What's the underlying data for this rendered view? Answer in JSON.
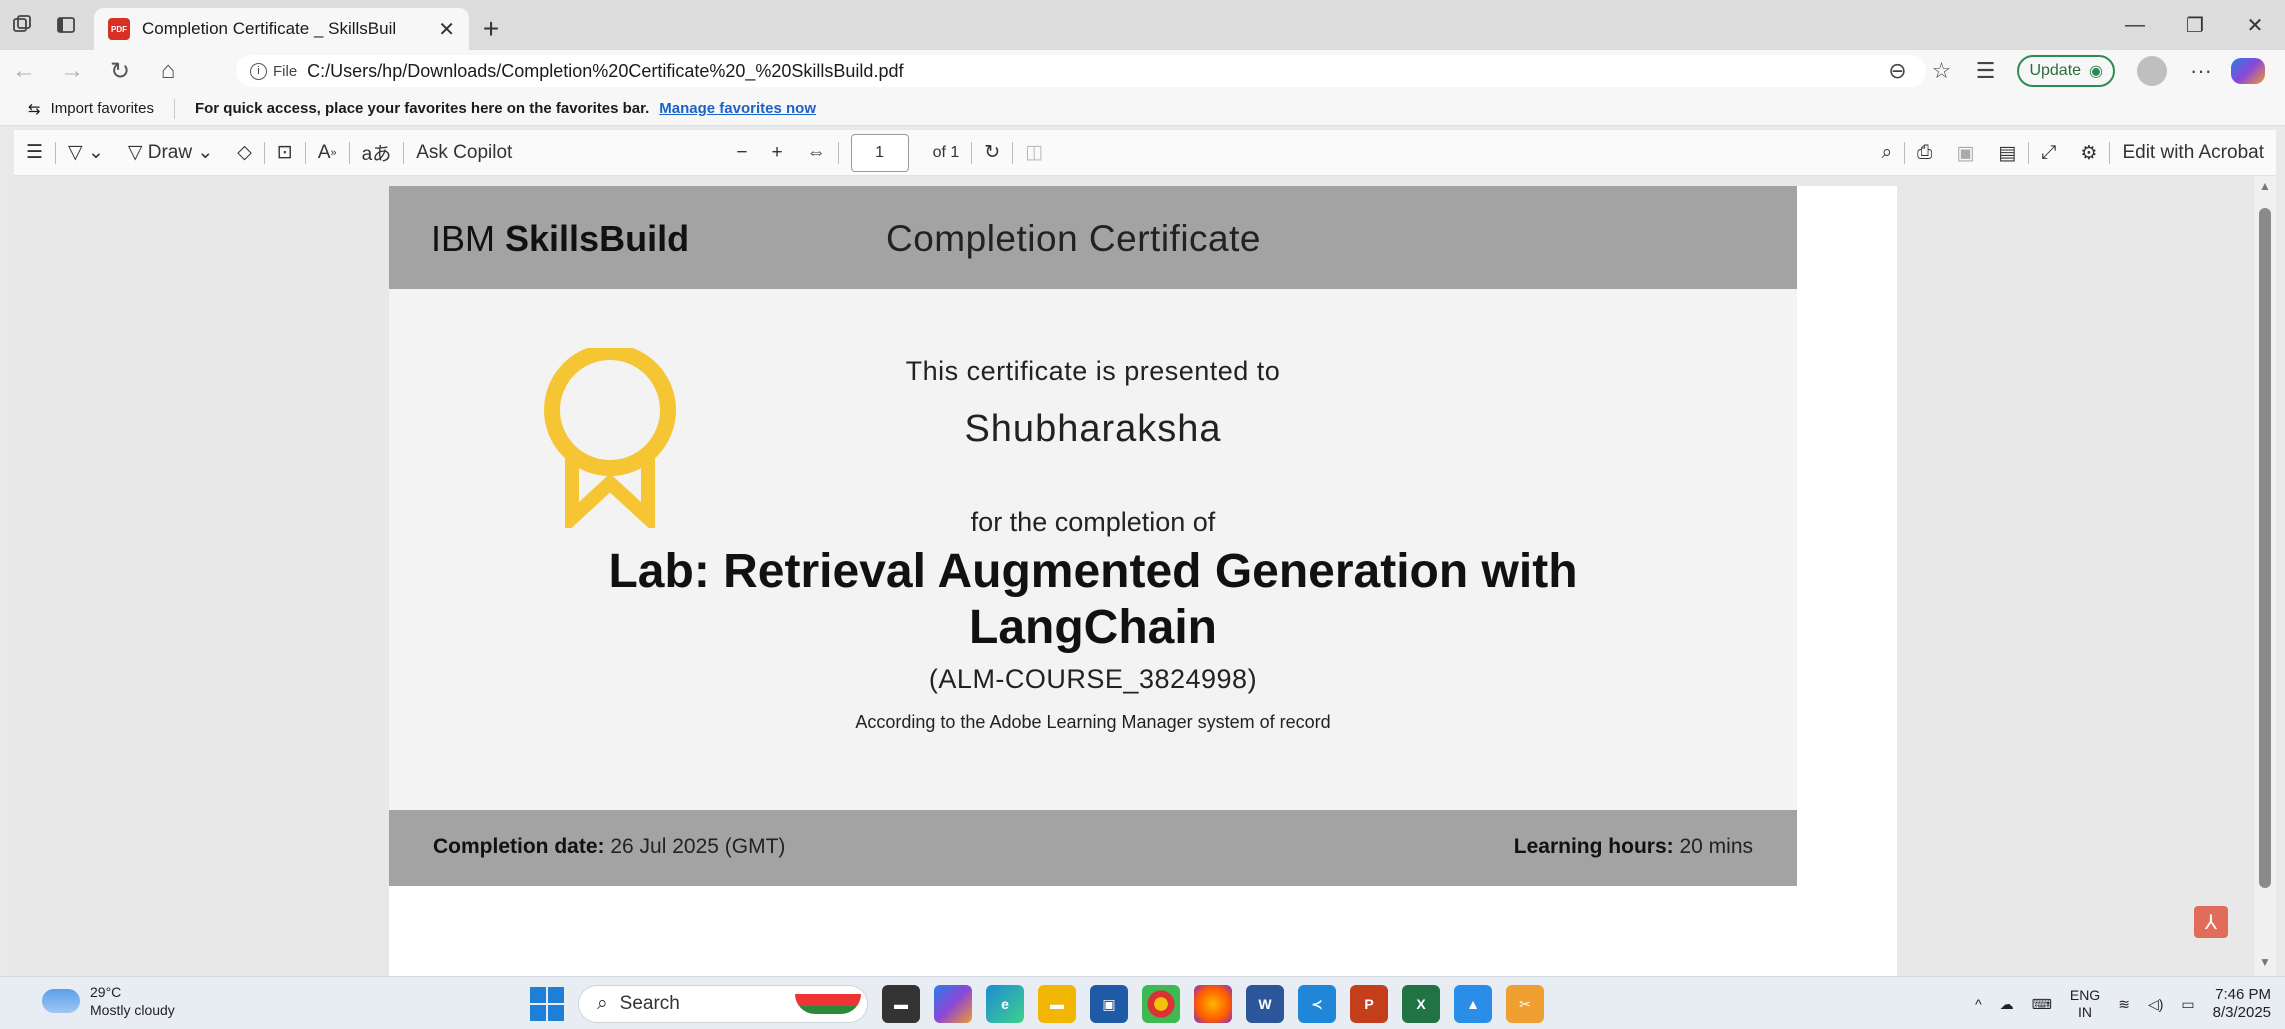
{
  "browser": {
    "tab_title": "Completion Certificate _ SkillsBuil",
    "tab_badge": "PDF",
    "url_chip": "File",
    "url": "C:/Users/hp/Downloads/Completion%20Certificate%20_%20SkillsBuild.pdf",
    "update_label": "Update",
    "favorites": {
      "import_label": "Import favorites",
      "hint": "For quick access, place your favorites here on the favorites bar.",
      "manage_link": "Manage favorites now"
    }
  },
  "pdf_toolbar": {
    "draw_label": "Draw",
    "read_aloud_label": "A",
    "translate_label": "aあ",
    "ask_copilot_label": "Ask Copilot",
    "page_number": "1",
    "page_total": "of 1",
    "edit_acrobat_label": "Edit with Acrobat"
  },
  "certificate": {
    "brand_prefix": "IBM ",
    "brand_name": "SkillsBuild",
    "heading": "Completion Certificate",
    "presented_to": "This certificate is presented to",
    "recipient": "Shubharaksha",
    "completion_of": "for the completion of",
    "course_title": "Lab: Retrieval Augmented Generation with LangChain",
    "course_code": "(ALM-COURSE_3824998)",
    "record_note": "According to the Adobe Learning Manager system of record",
    "completion_date_label": "Completion date:",
    "completion_date_value": "26 Jul 2025 (GMT)",
    "learning_hours_label": "Learning hours:",
    "learning_hours_value": "20 mins",
    "medal_color": "#f5c533"
  },
  "taskbar": {
    "weather_temp": "29°C",
    "weather_desc": "Mostly cloudy",
    "search_placeholder": "Search",
    "lang_line1": "ENG",
    "lang_line2": "IN",
    "time": "7:46 PM",
    "date": "8/3/2025"
  }
}
